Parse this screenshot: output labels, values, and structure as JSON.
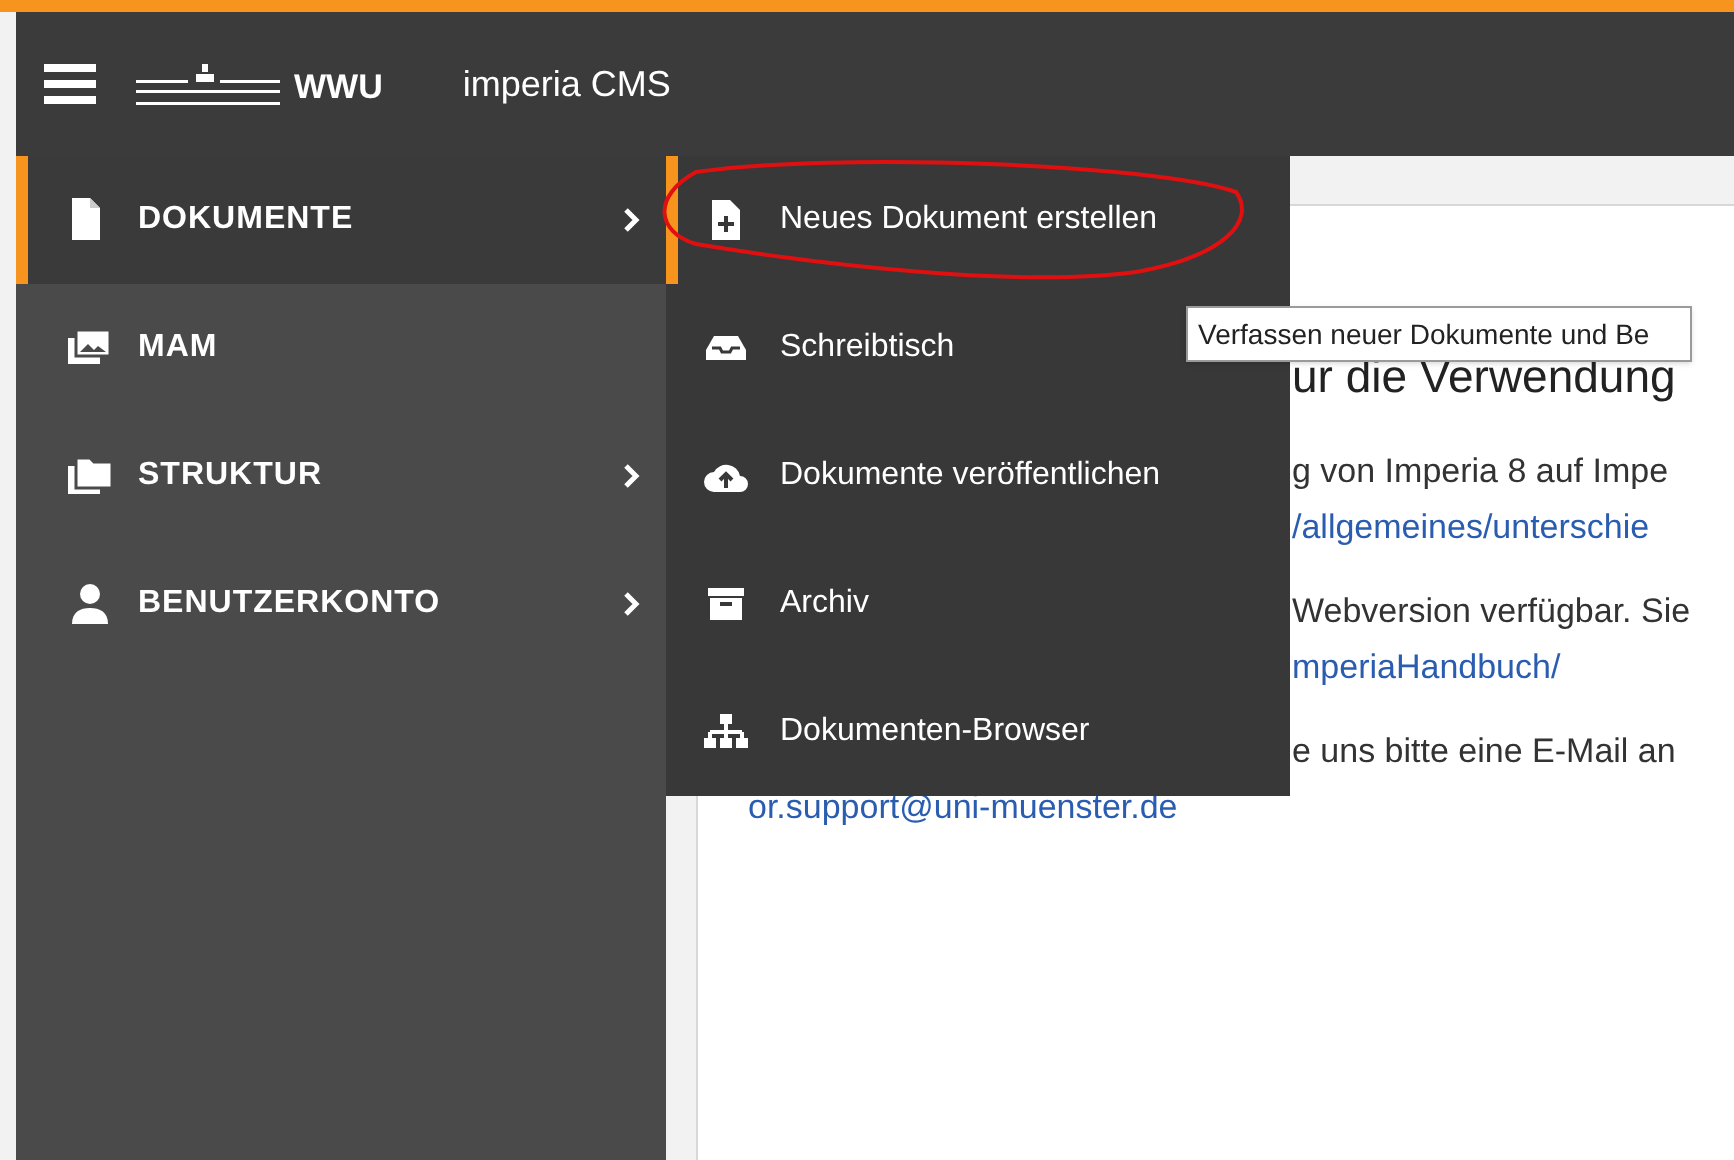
{
  "header": {
    "logo_text": "WWU",
    "title": "imperia CMS"
  },
  "sidebar": {
    "items": [
      {
        "label": "DOKUMENTE",
        "selected": true,
        "has_submenu": true
      },
      {
        "label": "MAM",
        "selected": false,
        "has_submenu": false
      },
      {
        "label": "STRUKTUR",
        "selected": false,
        "has_submenu": true
      },
      {
        "label": "BENUTZERKONTO",
        "selected": false,
        "has_submenu": true
      }
    ]
  },
  "submenu": {
    "items": [
      {
        "label": "Neues Dokument erstellen",
        "selected": true
      },
      {
        "label": "Schreibtisch",
        "selected": false
      },
      {
        "label": "Dokumente veröffentlichen",
        "selected": false
      },
      {
        "label": "Archiv",
        "selected": false
      },
      {
        "label": "Dokumenten-Browser",
        "selected": false
      }
    ]
  },
  "tooltip": "Verfassen neuer Dokumente und Be",
  "content": {
    "lines": [
      {
        "kind": "heading",
        "text": "ur die Verwendung"
      },
      {
        "kind": "text",
        "text": "g von Imperia 8 auf Impe"
      },
      {
        "kind": "link",
        "text": "/allgemeines/unterschie"
      },
      {
        "kind": "text",
        "text": "Webversion verfügbar. Sie"
      },
      {
        "kind": "link",
        "text": "mperiaHandbuch/"
      },
      {
        "kind": "text",
        "text": "e uns bitte eine E-Mail an"
      },
      {
        "kind": "email",
        "text": "or.support@uni-muenster.de"
      }
    ]
  }
}
